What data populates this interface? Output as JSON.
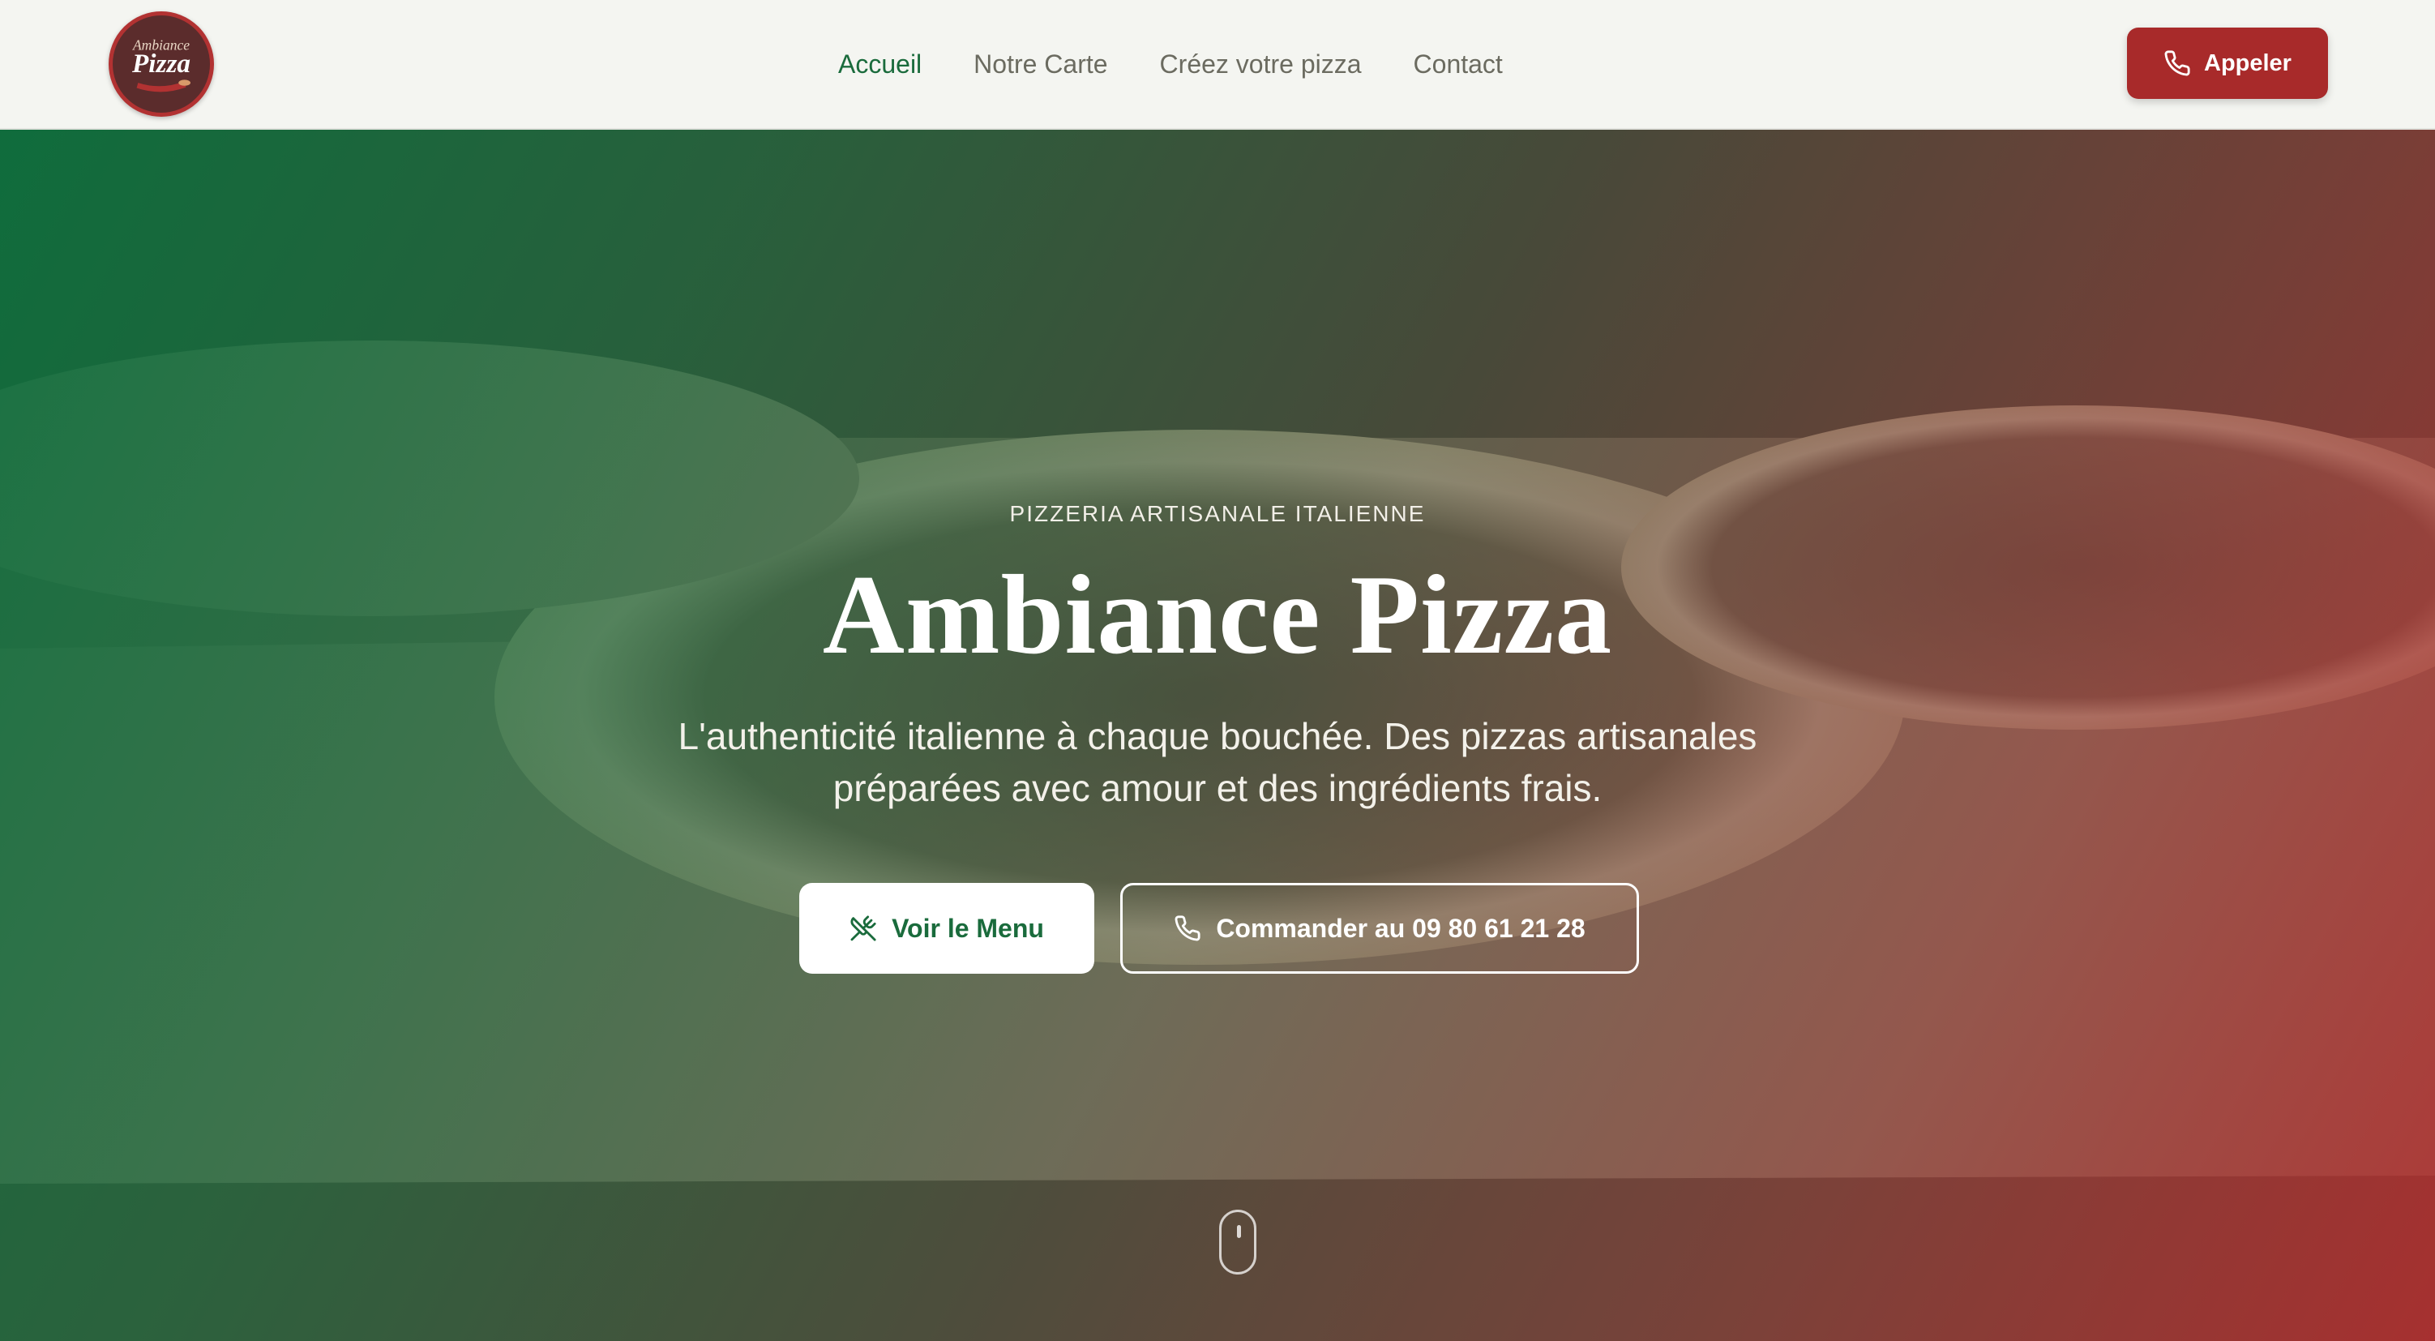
{
  "header": {
    "logo": {
      "icon": "ambiance-pizza-logo",
      "script_text": "Ambiance",
      "main_text": "Pizza"
    },
    "nav": [
      {
        "label": "Accueil",
        "active": true
      },
      {
        "label": "Notre Carte",
        "active": false
      },
      {
        "label": "Créez votre pizza",
        "active": false
      },
      {
        "label": "Contact",
        "active": false
      }
    ],
    "call_button": {
      "label": "Appeler",
      "icon": "phone-icon"
    }
  },
  "hero": {
    "eyebrow": "PIZZERIA ARTISANALE ITALIENNE",
    "title": "Ambiance Pizza",
    "subtitle_line1": "L'authenticité italienne à chaque bouchée. Des pizzas artisanales",
    "subtitle_line2": "préparées avec amour et des ingrédients frais.",
    "menu_button": {
      "label": "Voir le Menu",
      "icon": "utensils-crossed-icon"
    },
    "order_button": {
      "label": "Commander au 09 80 61 21 28",
      "icon": "phone-icon"
    },
    "scroll_indicator": "mouse-scroll-icon"
  },
  "colors": {
    "brand_green": "#1a6b3c",
    "brand_red": "#a82a2a",
    "header_bg": "#f4f5f1",
    "nav_text": "#6b6b60"
  }
}
